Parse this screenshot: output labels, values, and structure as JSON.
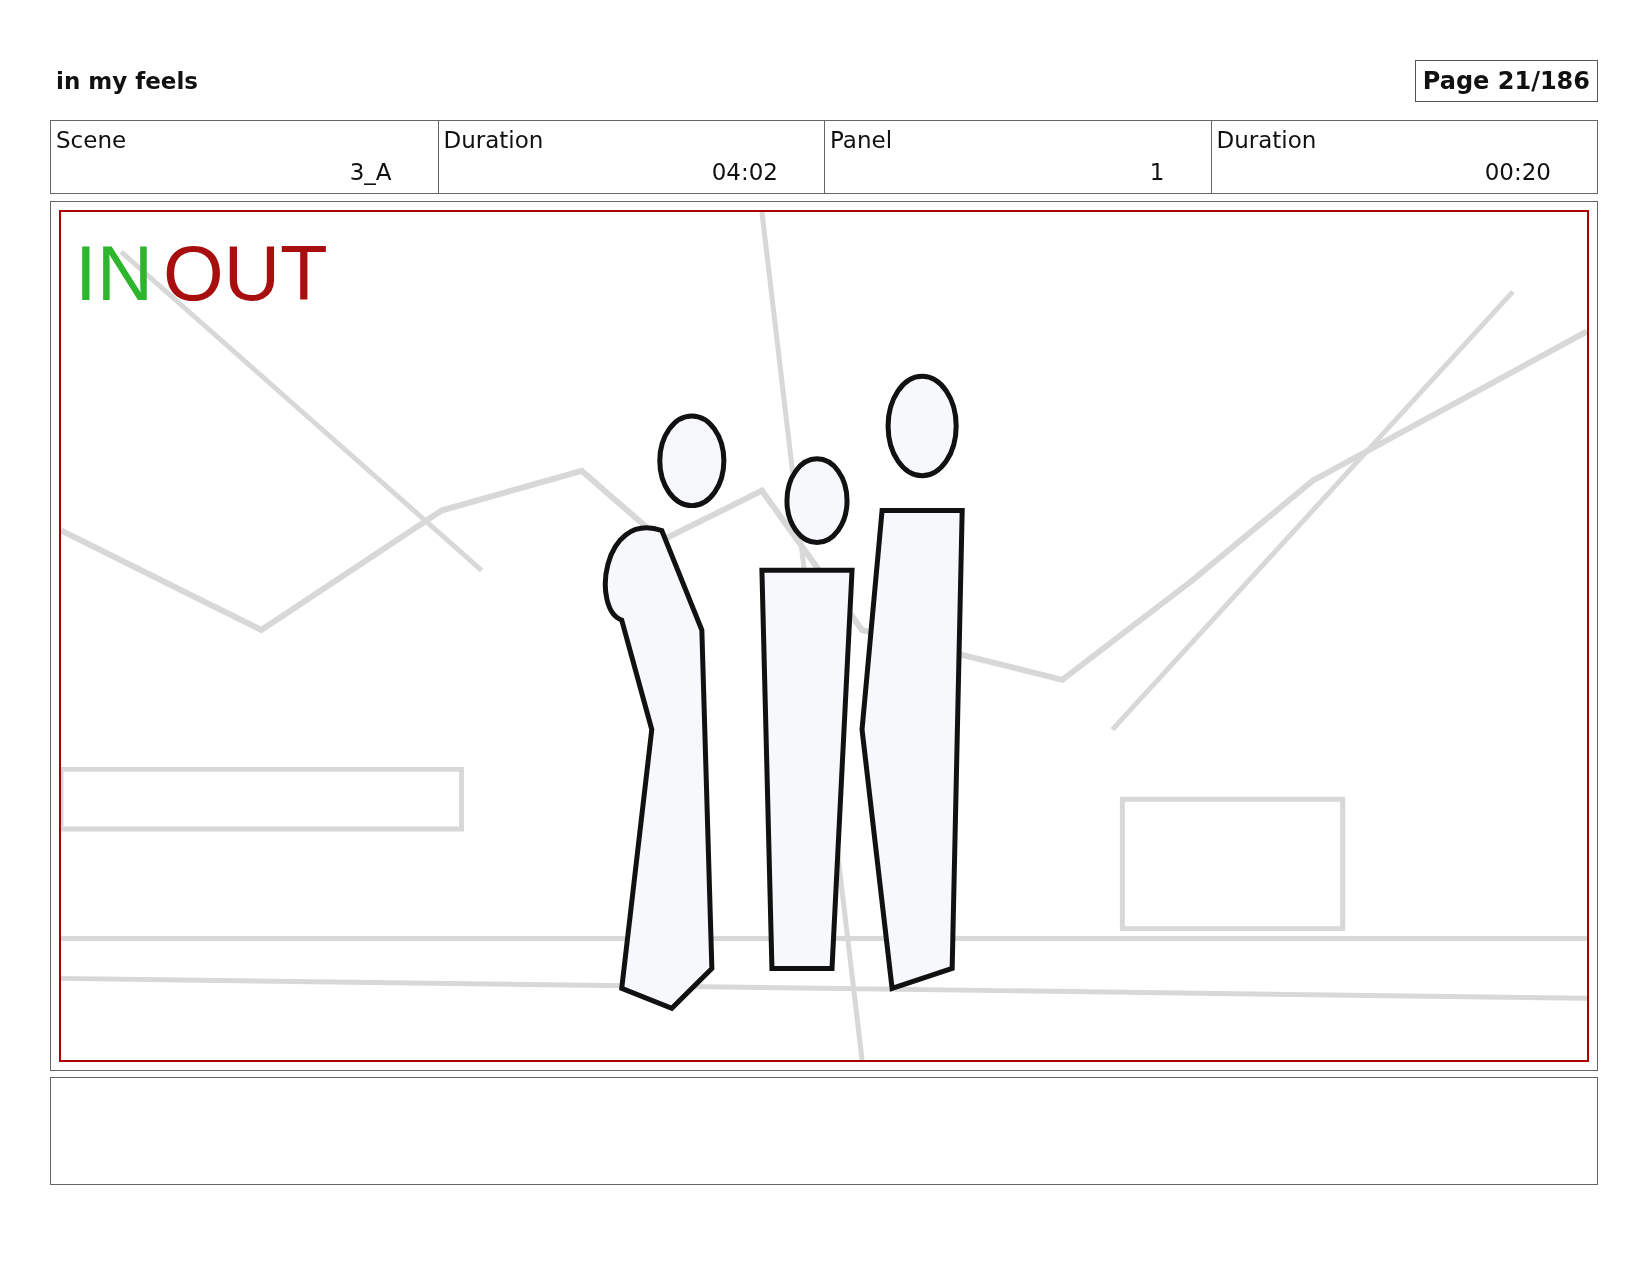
{
  "title": "in my feels",
  "page": "Page  21/186",
  "info": [
    {
      "label": "Scene",
      "value": "3_A"
    },
    {
      "label": "Duration",
      "value": "04:02"
    },
    {
      "label": "Panel",
      "value": "1"
    },
    {
      "label": "Duration",
      "value": "00:20"
    }
  ],
  "panel": {
    "in_label": "IN",
    "out_label": "OUT"
  }
}
